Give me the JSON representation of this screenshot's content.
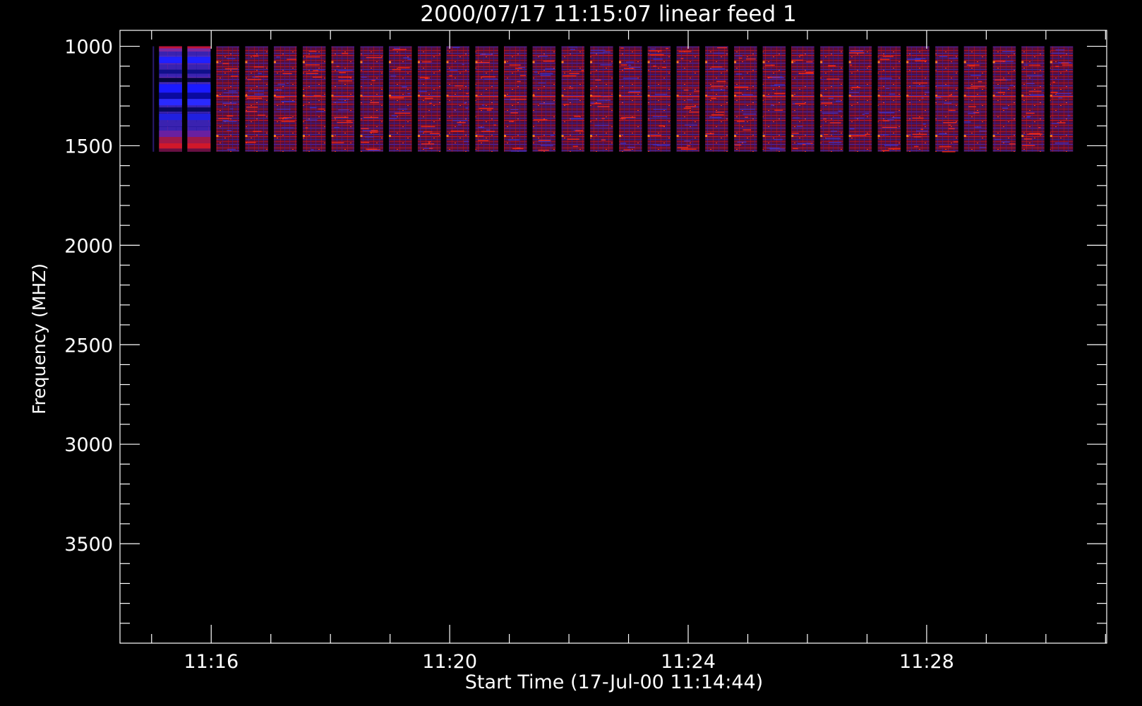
{
  "chart_data": {
    "type": "heatmap",
    "title": "2000/07/17 11:15:07 linear feed 1",
    "xlabel": "Start Time (17-Jul-00 11:14:44)",
    "ylabel": "Frequency (MHZ)",
    "x_axis": {
      "unit": "minutes after 11:00",
      "range": [
        14.47,
        31.02
      ],
      "major_ticks": [
        16,
        20,
        24,
        28
      ],
      "tick_labels": [
        "11:16",
        "11:20",
        "11:24",
        "11:28"
      ],
      "minor_tick_step": 1
    },
    "y_axis": {
      "unit": "MHz",
      "inverted": true,
      "range": [
        920,
        4000
      ],
      "major_ticks": [
        1000,
        1500,
        2000,
        2500,
        3000,
        3500
      ],
      "tick_labels": [
        "1000",
        "1500",
        "2000",
        "2500",
        "3000",
        "3500"
      ],
      "minor_tick_step": 100
    },
    "data_band": {
      "freq_start_mhz": 1000,
      "freq_end_mhz": 1530
    },
    "scans": [
      {
        "start": 15.125,
        "end": 15.51,
        "style": "blue"
      },
      {
        "start": 15.6,
        "end": 15.99,
        "style": "blue"
      },
      {
        "start": 16.085,
        "end": 16.47,
        "style": "red"
      },
      {
        "start": 16.57,
        "end": 16.955,
        "style": "red"
      },
      {
        "start": 17.05,
        "end": 17.435,
        "style": "red"
      },
      {
        "start": 17.535,
        "end": 17.92,
        "style": "red"
      },
      {
        "start": 18.015,
        "end": 18.4,
        "style": "red"
      },
      {
        "start": 18.5,
        "end": 18.885,
        "style": "red"
      },
      {
        "start": 18.98,
        "end": 19.365,
        "style": "red"
      },
      {
        "start": 19.465,
        "end": 19.85,
        "style": "red"
      },
      {
        "start": 19.945,
        "end": 20.33,
        "style": "red"
      },
      {
        "start": 20.43,
        "end": 20.815,
        "style": "red"
      },
      {
        "start": 20.91,
        "end": 21.295,
        "style": "red"
      },
      {
        "start": 21.39,
        "end": 21.775,
        "style": "red"
      },
      {
        "start": 21.875,
        "end": 22.26,
        "style": "red"
      },
      {
        "start": 22.355,
        "end": 22.74,
        "style": "red"
      },
      {
        "start": 22.84,
        "end": 23.225,
        "style": "red"
      },
      {
        "start": 23.32,
        "end": 23.705,
        "style": "red"
      },
      {
        "start": 23.805,
        "end": 24.19,
        "style": "red"
      },
      {
        "start": 24.285,
        "end": 24.67,
        "style": "red"
      },
      {
        "start": 24.77,
        "end": 25.155,
        "style": "red"
      },
      {
        "start": 25.25,
        "end": 25.635,
        "style": "red"
      },
      {
        "start": 25.73,
        "end": 26.115,
        "style": "red"
      },
      {
        "start": 26.215,
        "end": 26.6,
        "style": "red"
      },
      {
        "start": 26.695,
        "end": 27.08,
        "style": "red"
      },
      {
        "start": 27.18,
        "end": 27.565,
        "style": "red"
      },
      {
        "start": 27.66,
        "end": 28.045,
        "style": "red"
      },
      {
        "start": 28.145,
        "end": 28.53,
        "style": "red"
      },
      {
        "start": 28.625,
        "end": 29.01,
        "style": "red"
      },
      {
        "start": 29.11,
        "end": 29.495,
        "style": "red"
      },
      {
        "start": 29.59,
        "end": 29.975,
        "style": "red"
      },
      {
        "start": 30.07,
        "end": 30.455,
        "style": "red"
      }
    ],
    "colors": {
      "background": "#000000",
      "axes": "#ffffff",
      "red_base": "#6a1040",
      "blue_base": "#3a22b0",
      "blue_bright": "#1a1aff",
      "red_bright": "#ff2a10",
      "orange_spot": "#ff7a1a"
    },
    "grid": false,
    "legend": "none"
  }
}
